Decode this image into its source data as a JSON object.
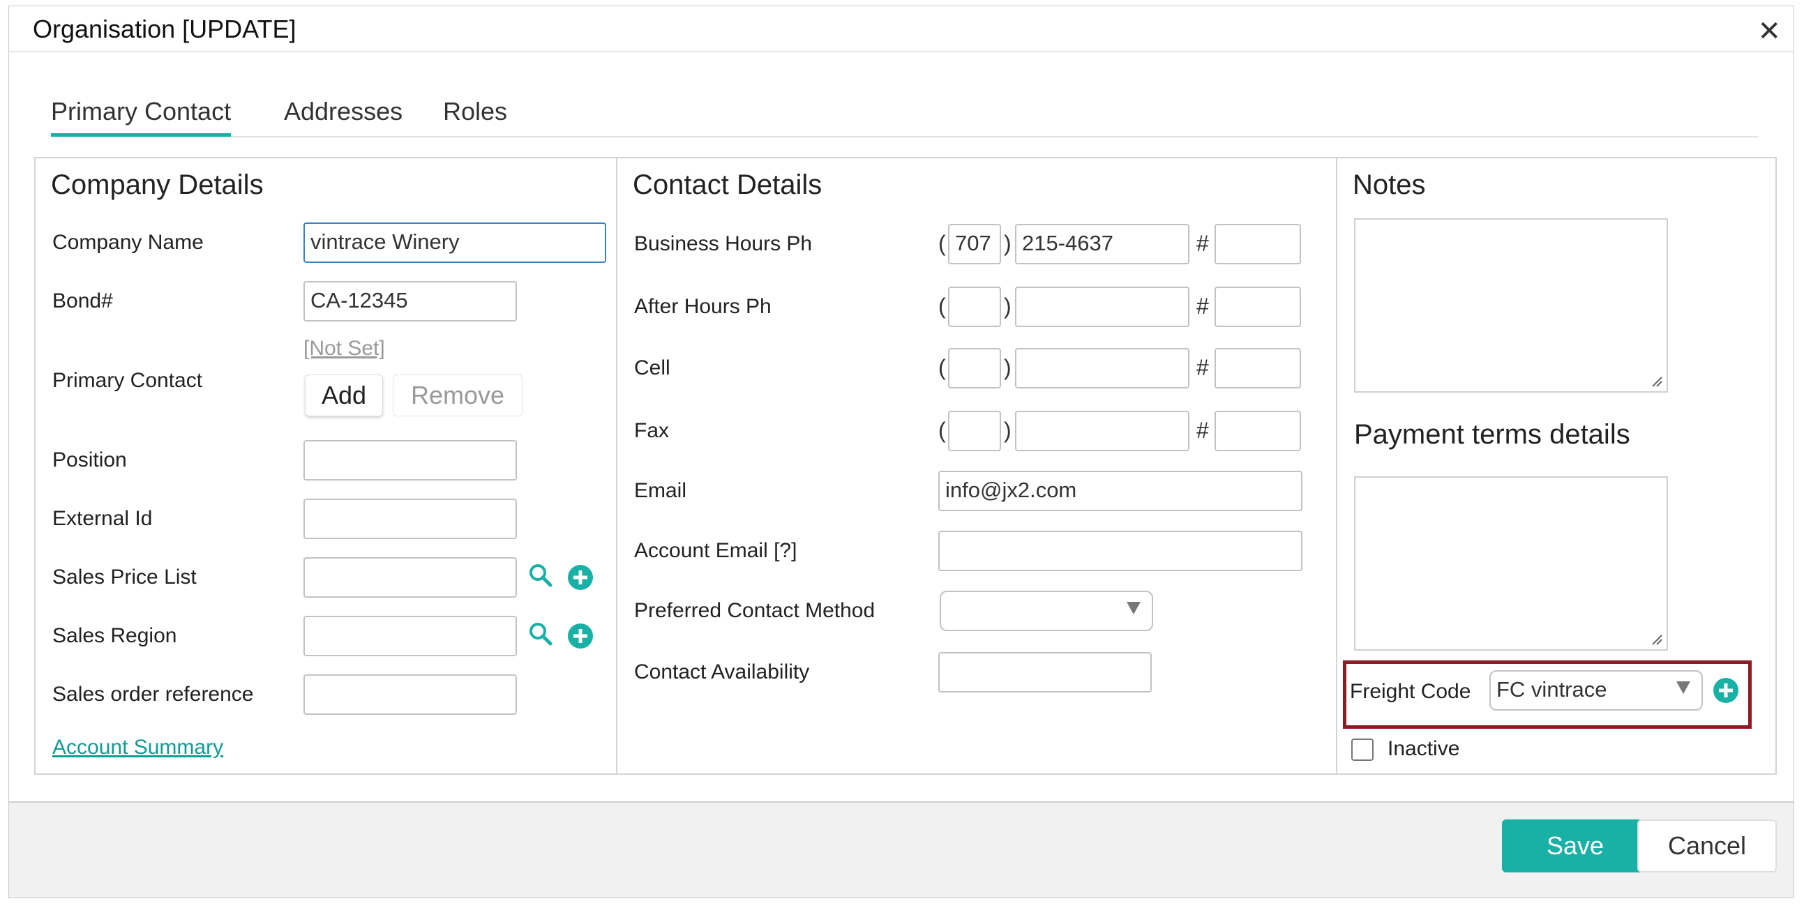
{
  "window": {
    "title": "Organisation [UPDATE]",
    "close_glyph": "✕"
  },
  "tabs": [
    {
      "label": "Primary Contact",
      "active": true
    },
    {
      "label": "Addresses",
      "active": false
    },
    {
      "label": "Roles",
      "active": false
    }
  ],
  "company": {
    "heading": "Company Details",
    "company_name_label": "Company Name",
    "company_name_value": "vintrace Winery",
    "bond_label": "Bond#",
    "bond_value": "CA-12345",
    "primary_contact_label": "Primary Contact",
    "primary_contact_value": "[Not Set]",
    "add_label": "Add",
    "remove_label": "Remove",
    "position_label": "Position",
    "external_id_label": "External Id",
    "sales_price_list_label": "Sales Price List",
    "sales_region_label": "Sales Region",
    "sales_order_ref_label": "Sales order reference",
    "account_summary_link": "Account Summary"
  },
  "contact": {
    "heading": "Contact Details",
    "business_hours_label": "Business Hours Ph",
    "business_area": "707",
    "business_number": "215-4637",
    "after_hours_label": "After Hours Ph",
    "cell_label": "Cell",
    "fax_label": "Fax",
    "email_label": "Email",
    "email_value": "info@jx2.com",
    "account_email_label": "Account Email [?]",
    "preferred_method_label": "Preferred Contact Method",
    "availability_label": "Contact Availability",
    "open_paren": "(",
    "close_paren": ")",
    "hash": "#"
  },
  "notes": {
    "heading": "Notes",
    "payment_heading": "Payment terms details",
    "freight_label": "Freight Code",
    "freight_value": "FC vintrace",
    "inactive_label": "Inactive",
    "inactive_checked": false
  },
  "footer": {
    "save_label": "Save",
    "cancel_label": "Cancel"
  },
  "colors": {
    "accent": "#19b0a6",
    "highlight": "#8e1b22",
    "link": "#0f9c93"
  },
  "icons": [
    "close-icon",
    "search-icon",
    "add-circle-icon",
    "dropdown-arrow-icon",
    "resize-grip-icon",
    "checkbox-icon"
  ]
}
